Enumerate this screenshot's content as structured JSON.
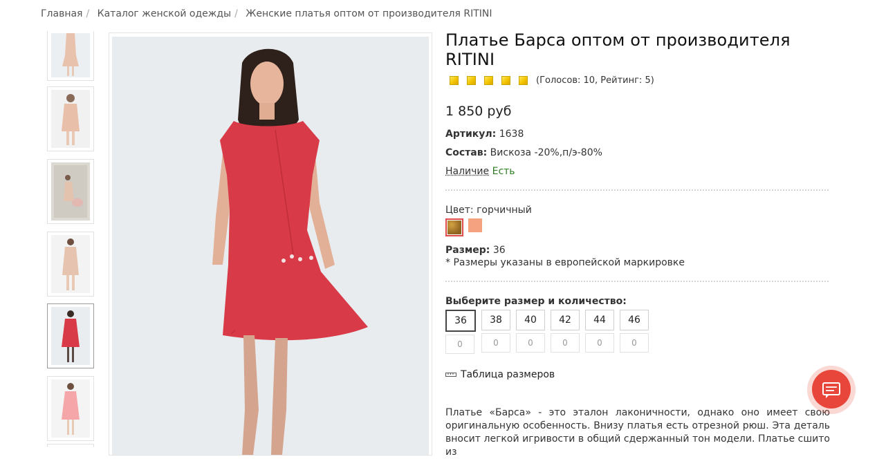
{
  "breadcrumb": {
    "items": [
      "Главная",
      "Каталог женской одежды",
      "Женские платья оптом от производителя RITINI"
    ],
    "separator": "/"
  },
  "product": {
    "title": "Платье Барса оптом от производителя RITINI",
    "rating_text": "(Голосов: 10, Рейтинг: 5)",
    "stars": 5,
    "price": "1 850 руб",
    "article_label": "Артикул:",
    "article_value": "1638",
    "composition_label": "Состав:",
    "composition_value": "Вискоза -20%,п/э-80%",
    "availability_label": "Наличие",
    "availability_value": "Есть",
    "color_label": "Цвет:",
    "color_value": "горчичный",
    "colors": [
      "#b58a2e",
      "#f4a27f"
    ],
    "size_label": "Размер:",
    "size_value": "36",
    "size_note": "* Размеры указаны в европейской маркировке",
    "choose_label": "Выберите размер и количество:",
    "sizes": [
      "36",
      "38",
      "40",
      "42",
      "44",
      "46"
    ],
    "quantities": [
      "0",
      "0",
      "0",
      "0",
      "0",
      "0"
    ],
    "size_table_link": "Таблица размеров",
    "description": "Платье «Барса» - это эталон лаконичности, однако оно имеет свою оригинальную особенность. Внизу платья есть отрезной рюш. Эта деталь вносит легкой игривости в общий сдержанный тон модели. Платье сшито из"
  },
  "colors": {
    "accent": "#e8463b",
    "dress_red": "#d93a48",
    "available_green": "#2e7d22"
  },
  "icons": {
    "ruler": "ruler-icon",
    "chat": "chat-icon",
    "star": "star-icon"
  }
}
